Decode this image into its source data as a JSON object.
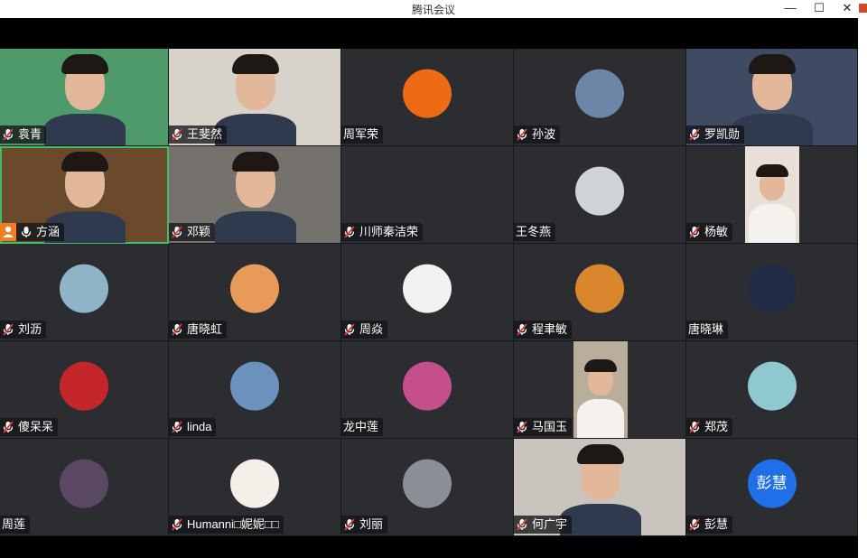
{
  "window": {
    "title": "腾讯会议"
  },
  "controls": {
    "minimize": "—",
    "maximize": "☐",
    "close": "✕"
  },
  "participants": [
    {
      "name": "袁青",
      "muted": true,
      "video": true,
      "color": "#4f9a6a"
    },
    {
      "name": "王斐然",
      "muted": true,
      "video": true,
      "color": "#d8d3c8"
    },
    {
      "name": "周军荣",
      "muted": false,
      "video": false,
      "color": "#ef6a14"
    },
    {
      "name": "孙波",
      "muted": true,
      "video": false,
      "color": "#6b86a6"
    },
    {
      "name": "罗凯勋",
      "muted": true,
      "video": true,
      "color": "#3f4b63"
    },
    {
      "name": "方涵",
      "muted": false,
      "video": true,
      "color": "#6b4a2c"
    },
    {
      "name": "邓颖",
      "muted": true,
      "video": true,
      "color": "#75726d"
    },
    {
      "name": "川师秦洁荣",
      "muted": true,
      "video": false,
      "color": ""
    },
    {
      "name": "王冬燕",
      "muted": false,
      "video": false,
      "color": "#cfd3d6"
    },
    {
      "name": "杨敏",
      "muted": true,
      "video": true,
      "color": "#e8e0d6"
    },
    {
      "name": "刘沥",
      "muted": true,
      "video": false,
      "color": "#8fb3c7"
    },
    {
      "name": "唐晓虹",
      "muted": true,
      "video": false,
      "color": "#e89a58"
    },
    {
      "name": "周焱",
      "muted": true,
      "video": false,
      "color": "#f2f2f2"
    },
    {
      "name": "程聿敏",
      "muted": true,
      "video": false,
      "color": "#d9862f"
    },
    {
      "name": "唐晓琳",
      "muted": false,
      "video": false,
      "color": "#1f2b45"
    },
    {
      "name": "傻呆呆",
      "muted": true,
      "video": false,
      "color": "#c5262c"
    },
    {
      "name": "linda",
      "muted": true,
      "video": false,
      "color": "#6b92bd"
    },
    {
      "name": "龙中莲",
      "muted": false,
      "video": false,
      "color": "#c44f8a"
    },
    {
      "name": "马国玉",
      "muted": true,
      "video": true,
      "color": "#b9ae9c"
    },
    {
      "name": "郑茂",
      "muted": true,
      "video": false,
      "color": "#8fc8cf"
    },
    {
      "name": "周莲",
      "muted": false,
      "video": false,
      "color": "#5a4862"
    },
    {
      "name": "Humanni□妮妮□□",
      "muted": true,
      "video": false,
      "color": "#f4efe8"
    },
    {
      "name": "刘丽",
      "muted": true,
      "video": false,
      "color": "#8d8f97"
    },
    {
      "name": "何广宇",
      "muted": true,
      "video": true,
      "color": "#c9c4bd"
    },
    {
      "name": "彭慧",
      "muted": true,
      "video": false,
      "color": "#1f6fe8",
      "avatar_text": "彭慧"
    }
  ],
  "fangmeng_badge": "person-icon"
}
